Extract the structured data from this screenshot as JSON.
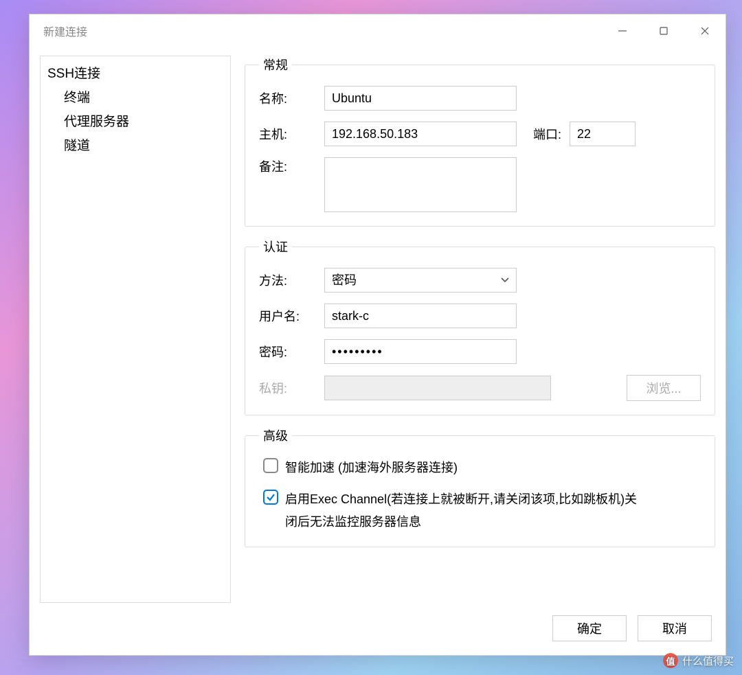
{
  "window": {
    "title": "新建连接"
  },
  "sidebar": {
    "root": "SSH连接",
    "items": [
      "终端",
      "代理服务器",
      "隧道"
    ]
  },
  "general": {
    "legend": "常规",
    "labels": {
      "name": "名称:",
      "host": "主机:",
      "port": "端口:",
      "note": "备注:"
    },
    "name": "Ubuntu",
    "host": "192.168.50.183",
    "port": "22",
    "note": ""
  },
  "auth": {
    "legend": "认证",
    "labels": {
      "method": "方法:",
      "username": "用户名:",
      "password": "密码:",
      "privkey": "私钥:"
    },
    "method": "密码",
    "username": "stark-c",
    "password": "•••••••••",
    "privkey": "",
    "browse": "浏览..."
  },
  "advanced": {
    "legend": "高级",
    "smart_accel": {
      "checked": false,
      "label": "智能加速 (加速海外服务器连接)"
    },
    "exec_channel": {
      "checked": true,
      "label": "启用Exec Channel(若连接上就被断开,请关闭该项,比如跳板机)关闭后无法监控服务器信息"
    }
  },
  "footer": {
    "ok": "确定",
    "cancel": "取消"
  },
  "watermark": {
    "badge": "值",
    "text": "什么值得买"
  }
}
